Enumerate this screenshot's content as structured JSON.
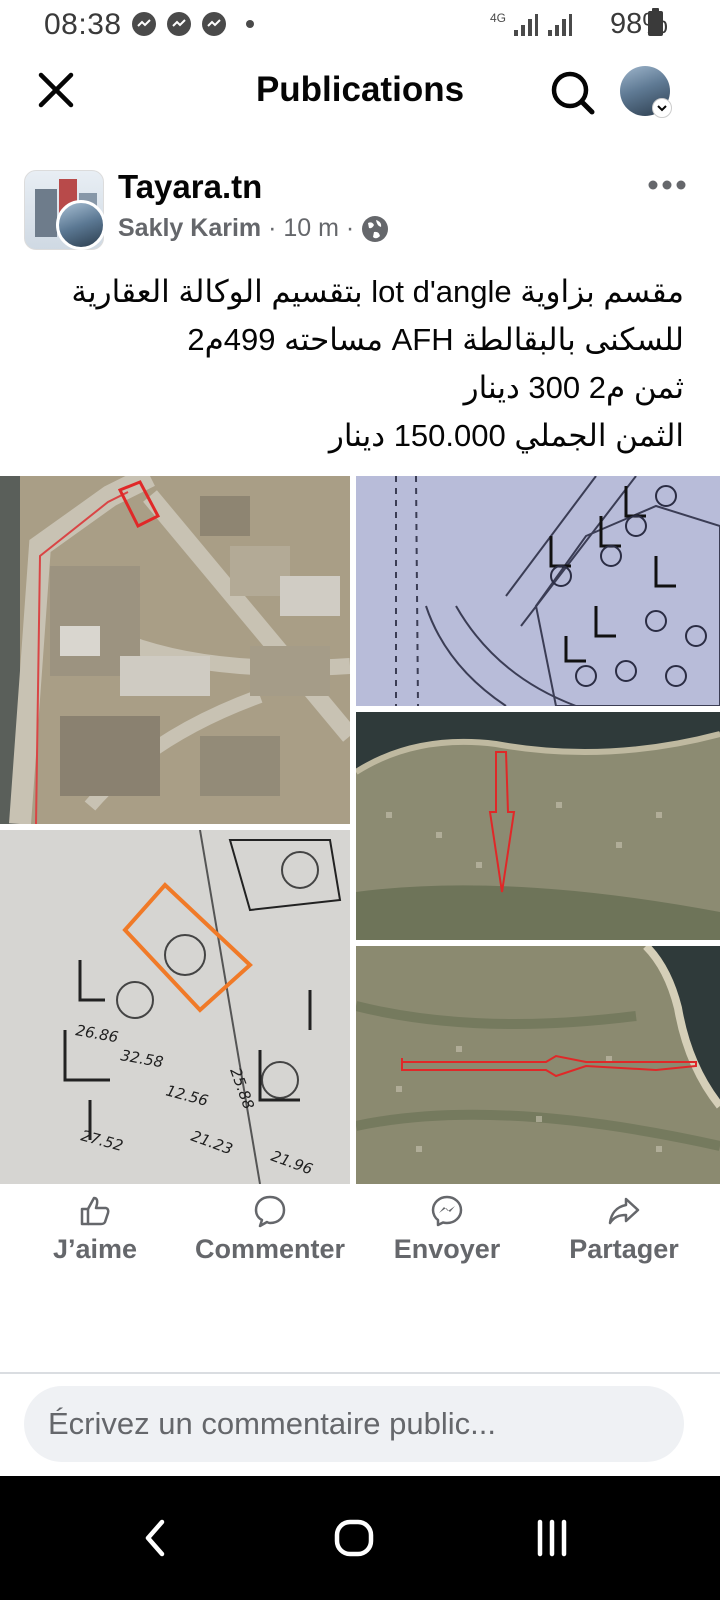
{
  "status": {
    "time": "08:38",
    "network": "4G",
    "battery": "98%"
  },
  "app_bar": {
    "title": "Publications",
    "icons": [
      "close-icon",
      "search-icon",
      "profile-avatar"
    ]
  },
  "post": {
    "page_name": "Tayara.tn",
    "author": "Sakly Karim",
    "separator": "·",
    "time_ago": "10 m",
    "audience_icon": "globe-icon",
    "text_lines": [
      "مقسم بزاوية  lot d'angle بتقسيم الوكالة العقارية",
      "للسكنى بالبقالطة AFH مساحته 499م2",
      "ثمن م2 300 دينار",
      "الثمن الجملي 150.000 دينار"
    ],
    "images": [
      "aerial-map",
      "subdivision-plan",
      "coastal-satellite",
      "handwritten-plan",
      "coastal-satellite-wide"
    ]
  },
  "actions": {
    "like": "J’aime",
    "comment": "Commenter",
    "send": "Envoyer",
    "share": "Partager"
  },
  "comment_input": {
    "placeholder": "Écrivez un commentaire public..."
  },
  "colors": {
    "text_primary": "#050505",
    "text_secondary": "#65676b",
    "input_bg": "#eff1f4",
    "annotation_red": "#d32f2f",
    "annotation_orange": "#f07a28"
  }
}
